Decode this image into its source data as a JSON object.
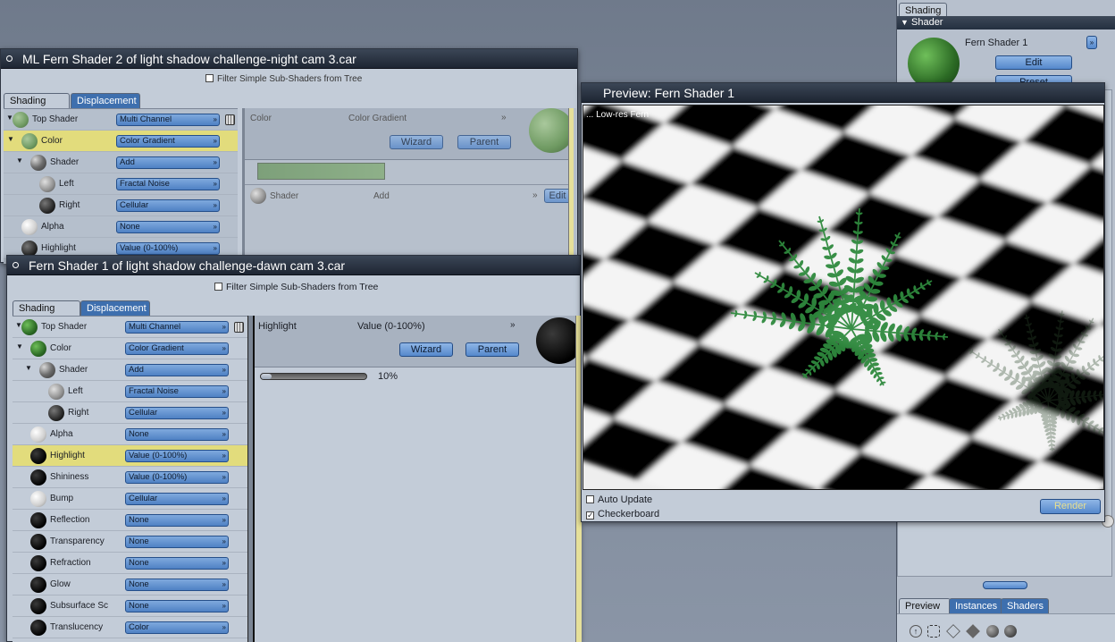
{
  "right_panel": {
    "tab": "Shading",
    "section": "Shader",
    "shader_name": "Fern Shader 1",
    "edit_label": "Edit",
    "preset_label": "Preset",
    "bottom_tabs": [
      "Preview",
      "Instances",
      "Shaders"
    ]
  },
  "win1": {
    "title": "ML Fern Shader 2 of light shadow challenge-night cam 3.car",
    "filter_label": "Filter Simple Sub-Shaders from Tree",
    "tabs": [
      "Shading",
      "Displacement"
    ],
    "tree": [
      {
        "label": "Top Shader",
        "value": "Multi Channel",
        "ball": "b-sgreen",
        "indent": 0
      },
      {
        "label": "Color",
        "value": "Color Gradient",
        "ball": "b-sgreen",
        "indent": 1,
        "selected": true
      },
      {
        "label": "Shader",
        "value": "Add",
        "ball": "b-mottle",
        "indent": 2
      },
      {
        "label": "Left",
        "value": "Fractal Noise",
        "ball": "b-gray",
        "indent": 3
      },
      {
        "label": "Right",
        "value": "Cellular",
        "ball": "b-dark",
        "indent": 3
      },
      {
        "label": "Alpha",
        "value": "None",
        "ball": "b-white",
        "indent": 1
      },
      {
        "label": "Highlight",
        "value": "Value (0-100%)",
        "ball": "b-dark",
        "indent": 1
      }
    ],
    "detail": {
      "channel": "Color",
      "type": "Color Gradient",
      "wizard": "Wizard",
      "parent": "Parent",
      "sub_label": "Shader",
      "sub_value": "Add",
      "sub_edit": "Edit"
    }
  },
  "win2": {
    "title": "Fern Shader 1 of light shadow challenge-dawn cam 3.car",
    "filter_label": "Filter Simple Sub-Shaders from Tree",
    "tabs": [
      "Shading",
      "Displacement"
    ],
    "tree": [
      {
        "label": "Top Shader",
        "value": "Multi Channel",
        "ball": "b-green",
        "indent": 0
      },
      {
        "label": "Color",
        "value": "Color Gradient",
        "ball": "b-green",
        "indent": 1
      },
      {
        "label": "Shader",
        "value": "Add",
        "ball": "b-mottle",
        "indent": 2
      },
      {
        "label": "Left",
        "value": "Fractal Noise",
        "ball": "b-gray",
        "indent": 3
      },
      {
        "label": "Right",
        "value": "Cellular",
        "ball": "b-dark",
        "indent": 3
      },
      {
        "label": "Alpha",
        "value": "None",
        "ball": "b-white",
        "indent": 1
      },
      {
        "label": "Highlight",
        "value": "Value (0-100%)",
        "ball": "b-black",
        "indent": 1,
        "selected": true
      },
      {
        "label": "Shininess",
        "value": "Value (0-100%)",
        "ball": "b-black",
        "indent": 1
      },
      {
        "label": "Bump",
        "value": "Cellular",
        "ball": "b-white",
        "indent": 1
      },
      {
        "label": "Reflection",
        "value": "None",
        "ball": "b-black",
        "indent": 1
      },
      {
        "label": "Transparency",
        "value": "None",
        "ball": "b-black",
        "indent": 1
      },
      {
        "label": "Refraction",
        "value": "None",
        "ball": "b-black",
        "indent": 1
      },
      {
        "label": "Glow",
        "value": "None",
        "ball": "b-black",
        "indent": 1
      },
      {
        "label": "Subsurface Sc",
        "value": "None",
        "ball": "b-black",
        "indent": 1
      },
      {
        "label": "Translucency",
        "value": "Color",
        "ball": "b-black",
        "indent": 1
      }
    ],
    "detail": {
      "channel": "Highlight",
      "type": "Value (0-100%)",
      "wizard": "Wizard",
      "parent": "Parent",
      "slider_value": "10%",
      "slider_fraction": 0.1
    }
  },
  "preview": {
    "title": "Preview: Fern Shader 1",
    "overlay": "... Low-res Fern",
    "auto_update": "Auto Update",
    "auto_update_checked": false,
    "checkerboard": "Checkerboard",
    "checkerboard_checked": true,
    "render": "Render"
  }
}
